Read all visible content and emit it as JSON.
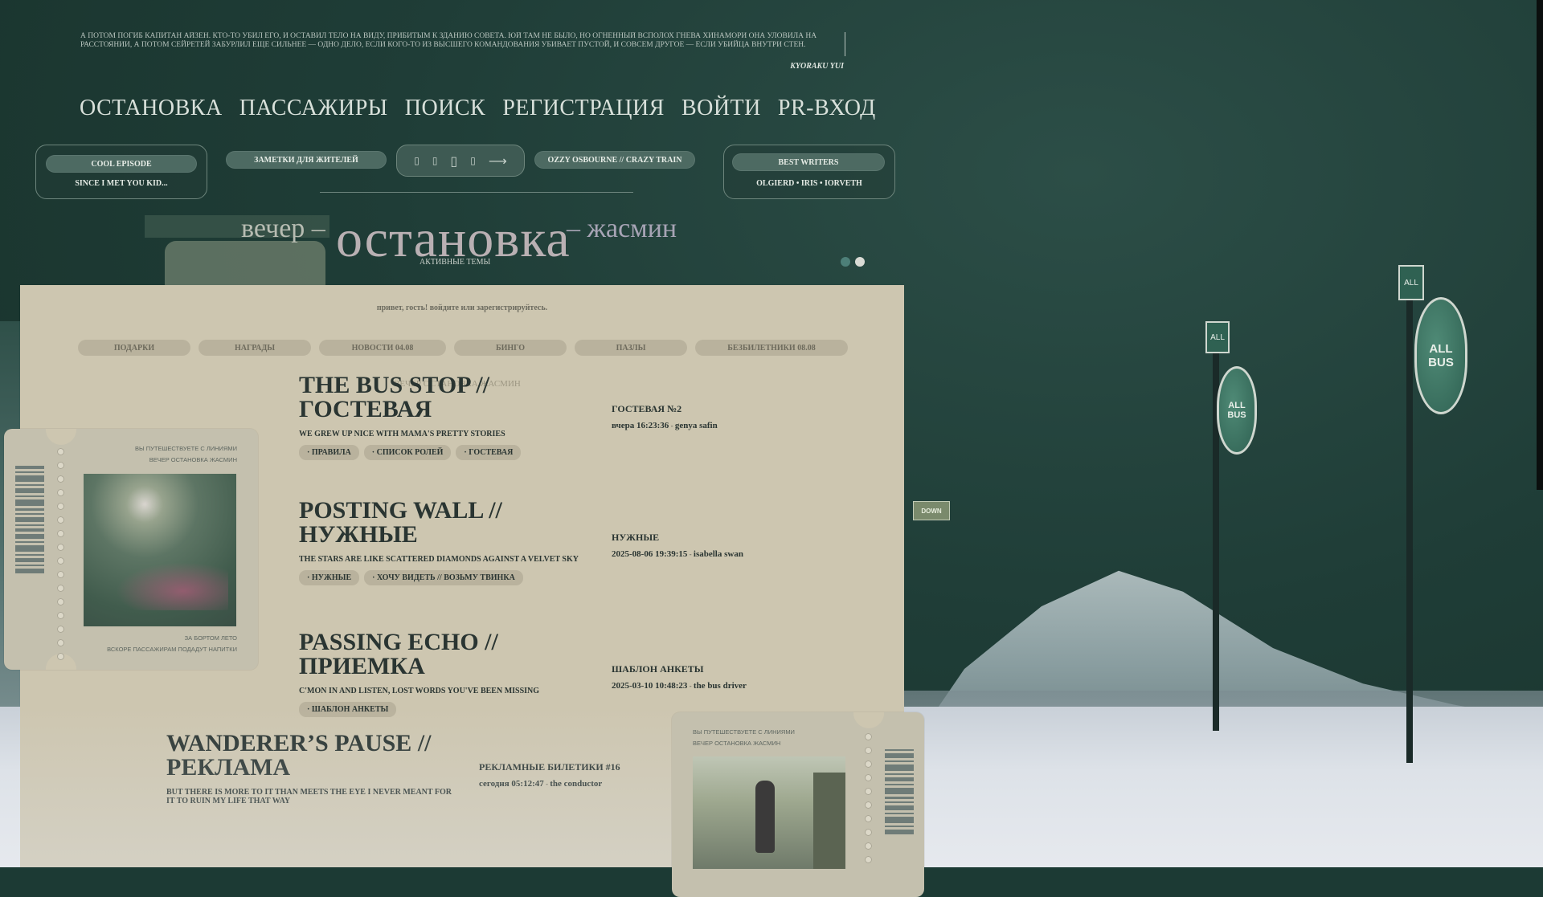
{
  "quote": {
    "text": "А потом погиб капитан Айзен. Кто-то убил его, и оставил тело на виду, прибитым к зданию Совета. Юй там не было, но огненный всполох гнева Хинамори она уловила на расстоянии, а потом Сейретей забурлил еще сильнее — одно дело, если кого-то из высшего командования убивает Пустой, и совсем другое — если убийца внутри стен.",
    "author": "KYORAKU YUI"
  },
  "nav": [
    "ОСТАНОВКА",
    "ПАССАЖИРЫ",
    "ПОИСК",
    "РЕГИСТРАЦИЯ",
    "ВОЙТИ",
    "PR-ВХОД"
  ],
  "widgets": {
    "cool_episode": {
      "label": "COOL EPISODE",
      "caption": "SINCE I MET YOU KID..."
    },
    "notes": {
      "label": "ЗАМЕТКИ ДЛЯ ЖИТЕЛЕЙ"
    },
    "player": {
      "track": "OZZY OSBOURNE // CRAZY TRAIN",
      "icons": [
        "prev-icon",
        "rewind-icon",
        "pause-icon",
        "forward-icon",
        "next-arrow-icon"
      ]
    },
    "best_writers": {
      "label": "BEST WRITERS",
      "caption": "OLGIERD • IRIS • IORVETH"
    }
  },
  "title": {
    "left": "вечер –",
    "main": "остановка",
    "right": "– жасмин",
    "subtitle": "АКТИВНЫЕ ТЕМЫ"
  },
  "colors": {
    "dot_active": "#4d7f78",
    "dot_inactive": "#d9dbd5",
    "panel": "#cdc6b0",
    "tab": "#b9b29d"
  },
  "panel": {
    "greeting": "привет, гость! войдите или зарегистрируйтесь.",
    "tabs": [
      "ПОДАРКИ",
      "НАГРАДЫ",
      "НОВОСТИ 04.08",
      "БИНГО",
      "ПАЗЛЫ",
      "БЕЗБИЛЕТНИКИ 08.08"
    ],
    "ghost_text": "ВЕЧЕР ОСТАНОВКА ЖАСМИН",
    "forums": [
      {
        "title": "THE BUS STOP // ГОСТЕВАЯ",
        "desc": "WE GREW UP NICE WITH MAMA'S PRETTY STORIES",
        "subforums": [
          "· ПРАВИЛА",
          "· СПИСОК РОЛЕЙ",
          "· ГОСТЕВАЯ"
        ],
        "last_topic": "ГОСТЕВАЯ №2",
        "last_date": "вчера 16:23:36",
        "last_author": "genya safin"
      },
      {
        "title": "POSTING WALL // НУЖНЫЕ",
        "desc": "THE STARS ARE LIKE SCATTERED DIAMONDS AGAINST A VELVET SKY",
        "subforums": [
          "· НУЖНЫЕ",
          "· ХОЧУ ВИДЕТЬ // ВОЗЬМУ ТВИНКА"
        ],
        "last_topic": "НУЖНЫЕ",
        "last_date": "2025-08-06 19:39:15",
        "last_author": "isabella swan"
      },
      {
        "title": "PASSING ECHO // ПРИЕМКА",
        "desc": "C'MON IN AND LISTEN, LOST WORDS YOU'VE BEEN MISSING",
        "subforums": [
          "· ШАБЛОН АНКЕТЫ"
        ],
        "last_topic": "ШАБЛОН АНКЕТЫ",
        "last_date": "2025-03-10 10:48:23",
        "last_author": "the bus driver"
      },
      {
        "title": "WANDERER’S PAUSE // РЕКЛАМА",
        "desc": "BUT THERE IS MORE TO IT THAN MEETS THE EYE I NEVER MEANT FOR IT TO RUIN MY LIFE THAT WAY",
        "subforums": [],
        "last_topic": "РЕКЛАМНЫЕ БИЛЕТИКИ #16",
        "last_date": "сегодня 05:12:47",
        "last_author": "the conductor"
      }
    ],
    "meta_sep": " - "
  },
  "ticket_left": {
    "line1": "ВЫ ПУТЕШЕСТВУЕТЕ С ЛИНИЯМИ",
    "line2": "ВЕЧЕР ОСТАНОВКА ЖАСМИН",
    "line3": "ЗА БОРТОМ ЛЕТО",
    "line4": "ВСКОРЕ ПАССАЖИРАМ ПОДАДУТ НАПИТКИ"
  },
  "ticket_right": {
    "line1": "ВЫ ПУТЕШЕСТВУЕТЕ С ЛИНИЯМИ",
    "line2": "ВЕЧЕР ОСТАНОВКА ЖАСМИН"
  },
  "signs": {
    "big": "ALL\nBUS",
    "small": "ALL\nBUS",
    "top": "ALL",
    "top2": "ALL"
  },
  "down_button": "DOWN"
}
